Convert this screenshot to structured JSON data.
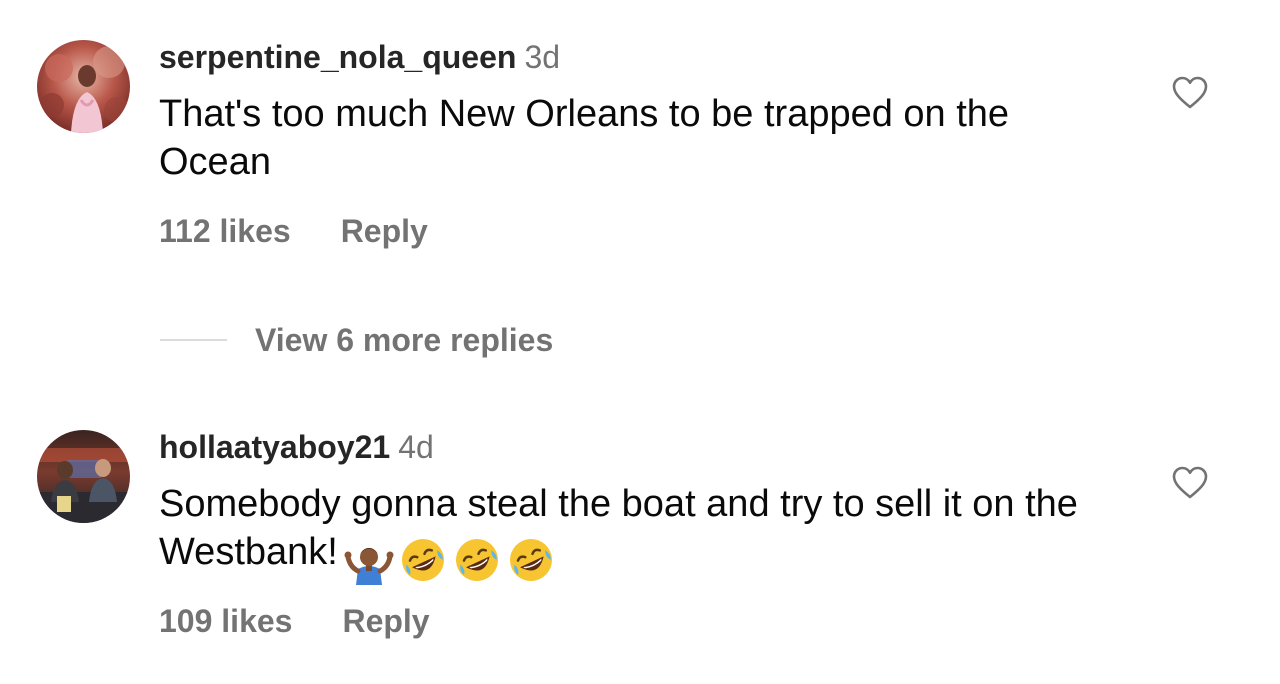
{
  "comments": [
    {
      "username": "serpentine_nola_queen",
      "timestamp": "3d",
      "text": "That's too much New Orleans to be trapped on the Ocean",
      "likes": "112 likes",
      "reply_label": "Reply",
      "liked": false
    },
    {
      "username": "hollaatyaboy21",
      "timestamp": "4d",
      "text": "Somebody gonna steal the boat and try to sell it on the Westbank!",
      "emojis": [
        "shrug-emoji",
        "rofl-emoji",
        "rofl-emoji",
        "rofl-emoji"
      ],
      "likes": "109 likes",
      "reply_label": "Reply",
      "liked": false
    }
  ],
  "view_replies": {
    "label": "View 6 more replies"
  },
  "colors": {
    "secondary_text": "#737373",
    "username": "#262626",
    "divider": "#dbdbdb",
    "heart_outline": "#737373"
  }
}
